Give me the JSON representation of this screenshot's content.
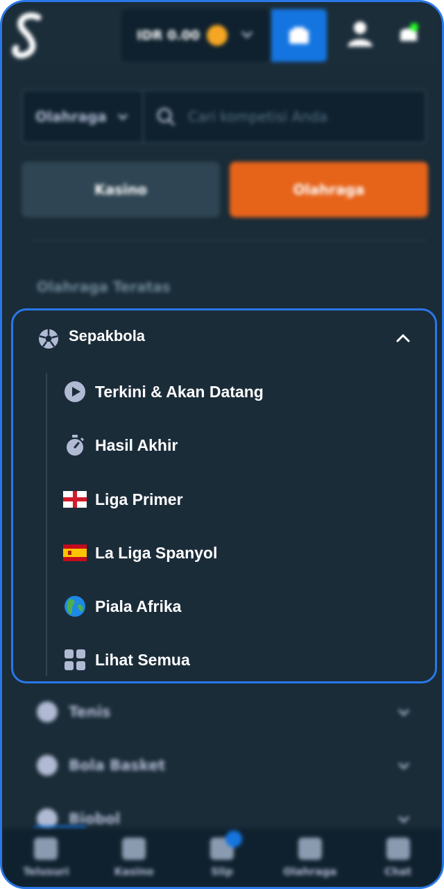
{
  "header": {
    "wallet_balance": "IDR 0.00",
    "accent_color": "#1475e1"
  },
  "search": {
    "type_label": "Olahraga",
    "placeholder": "Cari kompetisi Anda"
  },
  "tabs": [
    {
      "label": "Kasino"
    },
    {
      "label": "Olahraga"
    }
  ],
  "section_title": "Olahraga Teratas",
  "expanded": {
    "title": "Sepakbola",
    "items": [
      {
        "label": "Terkini & Akan Datang",
        "icon": "play-circle-icon"
      },
      {
        "label": "Hasil Akhir",
        "icon": "stopwatch-icon"
      },
      {
        "label": "Liga Primer",
        "icon": "england-flag-icon"
      },
      {
        "label": "La Liga Spanyol",
        "icon": "spain-flag-icon"
      },
      {
        "label": "Piala Afrika",
        "icon": "globe-icon"
      },
      {
        "label": "Lihat Semua",
        "icon": "grid-icon"
      }
    ]
  },
  "collapsed_sports": [
    {
      "label": "Tenis"
    },
    {
      "label": "Bola Basket"
    },
    {
      "label": "Biobol"
    }
  ],
  "bottom_nav": [
    {
      "label": "Telusuri"
    },
    {
      "label": "Kasino"
    },
    {
      "label": "Slip"
    },
    {
      "label": "Olahraga"
    },
    {
      "label": "Chat"
    }
  ]
}
